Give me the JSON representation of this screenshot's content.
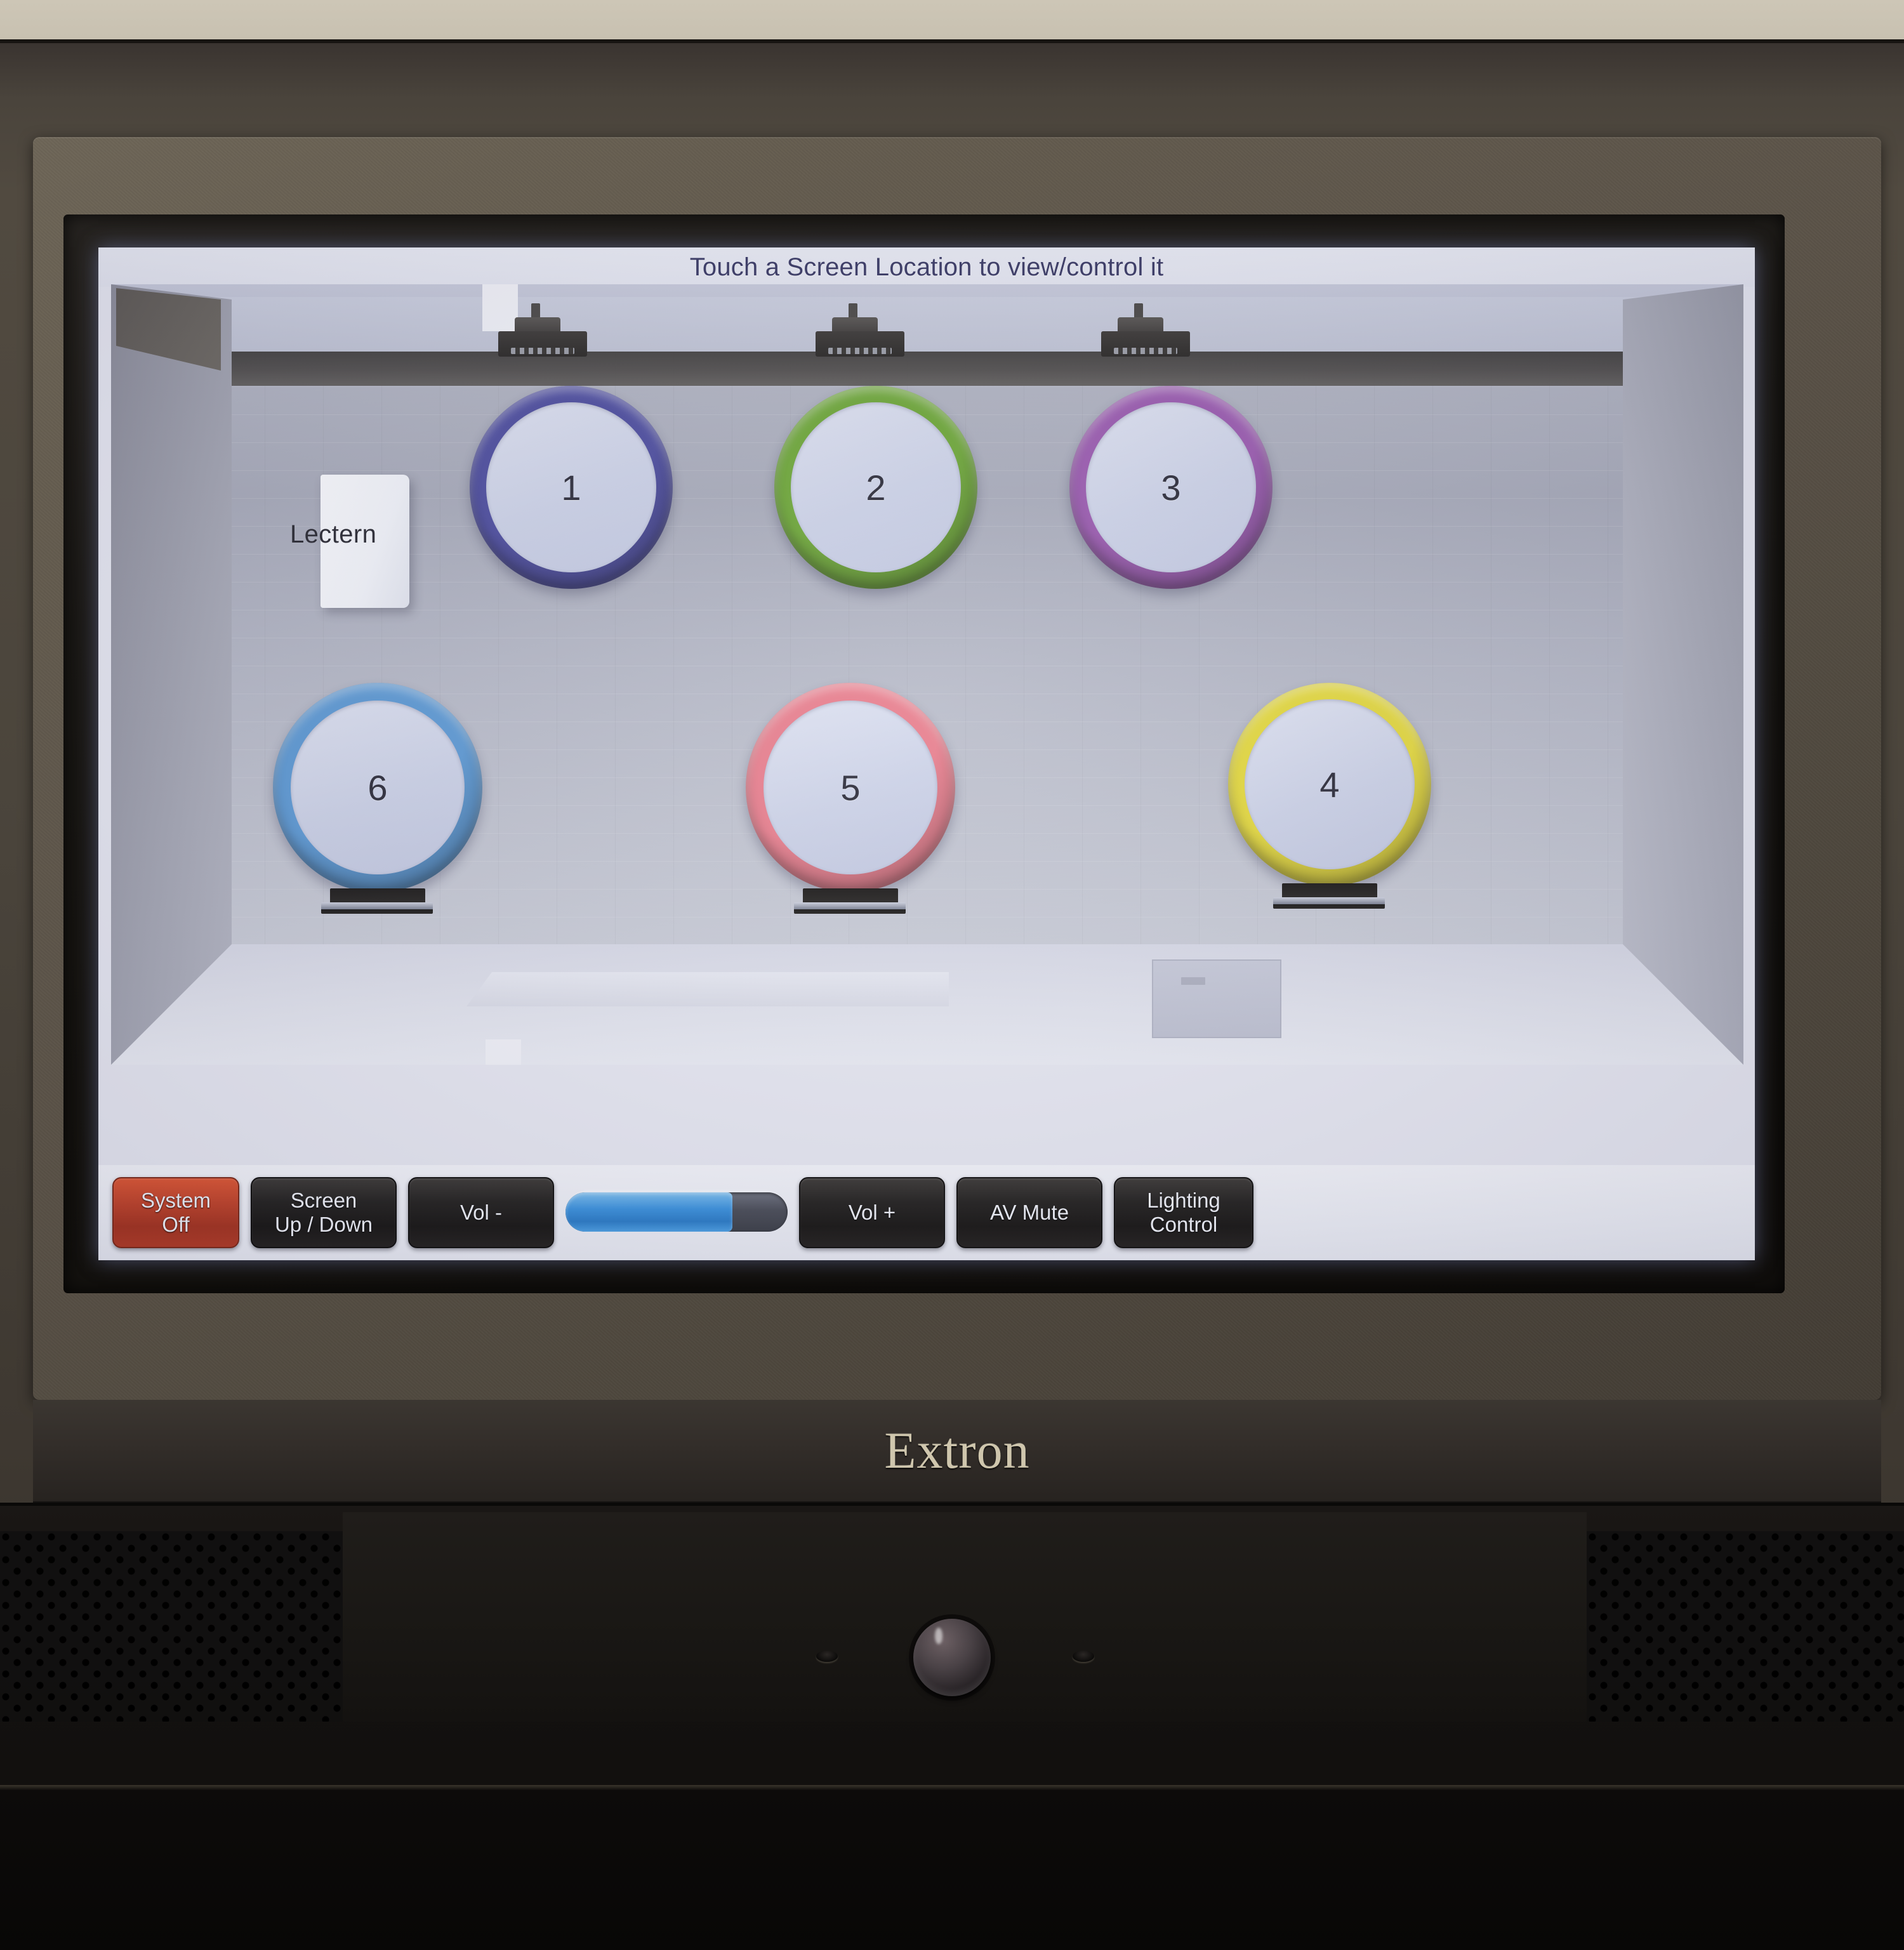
{
  "device": {
    "brand": "Extron",
    "knob_label": "power-knob"
  },
  "screen": {
    "header_title": "Touch a Screen Location to view/control it",
    "lectern_label": "Lectern"
  },
  "locations": [
    {
      "number": "1",
      "color": "#4f4fa0",
      "row": "top"
    },
    {
      "number": "2",
      "color": "#6fa83a",
      "row": "top"
    },
    {
      "number": "3",
      "color": "#9b5cb0",
      "row": "top"
    },
    {
      "number": "6",
      "color": "#5f9bd5",
      "row": "bottom"
    },
    {
      "number": "5",
      "color": "#e8808f",
      "row": "bottom"
    },
    {
      "number": "4",
      "color": "#e4d940",
      "row": "bottom"
    }
  ],
  "controls": {
    "system_off_line1": "System",
    "system_off_line2": "Off",
    "screen_line1": "Screen",
    "screen_line2": "Up / Down",
    "vol_minus": "Vol -",
    "vol_plus": "Vol +",
    "av_mute": "AV Mute",
    "lighting_line1": "Lighting",
    "lighting_line2": "Control",
    "volume_percent": 75,
    "accent_blue": "#3b93e0",
    "danger_red": "#c4442a"
  }
}
